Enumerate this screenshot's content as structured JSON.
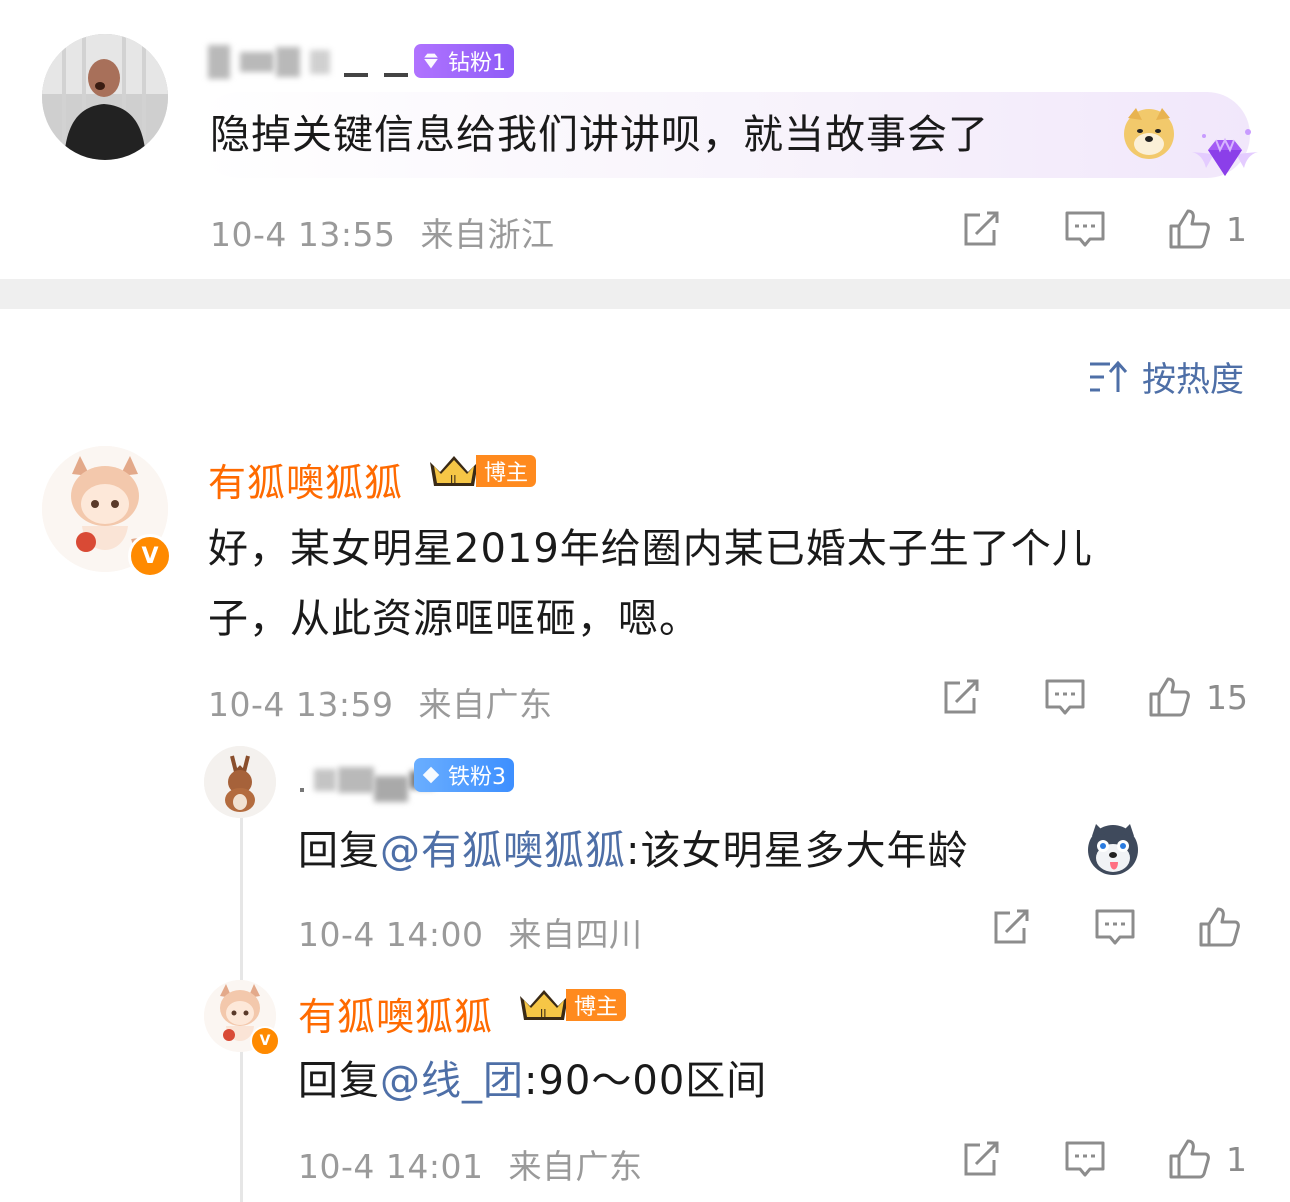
{
  "comment1": {
    "badge_label": "钻粉1",
    "text": "隐掉关键信息给我们讲讲呗，就当故事会了",
    "time": "10-4 13:55",
    "location": "来自浙江",
    "likes": "1"
  },
  "sort_label": "按热度",
  "comment2": {
    "author": "有狐噢狐狐",
    "badge_label": "博主",
    "text_line1": "好，某女明星2019年给圈内某已婚太子生了个儿",
    "text_line2": "子，从此资源哐哐砸，嗯。",
    "time": "10-4 13:59",
    "location": "来自广东",
    "likes": "15"
  },
  "reply1": {
    "badge_label": "铁粉3",
    "prefix": "回复",
    "mention": "@有狐噢狐狐",
    "text": ":该女明星多大年龄",
    "time": "10-4 14:00",
    "location": "来自四川"
  },
  "reply2": {
    "author": "有狐噢狐狐",
    "badge_label": "博主",
    "prefix": "回复",
    "mention": "@线_团",
    "text": ":90～00区间",
    "time": "10-4 14:01",
    "location": "来自广东",
    "likes": "1"
  },
  "colors": {
    "orange_name": "#ff6a00",
    "link_blue": "#4e6fa7",
    "meta_gray": "#9a9a9a",
    "diamond_badge": "#9b63f8",
    "iron_badge": "#4d97ff"
  },
  "icons": [
    "share-icon",
    "comment-icon",
    "like-icon",
    "sort-icon",
    "diamond-icon",
    "crown-icon"
  ]
}
